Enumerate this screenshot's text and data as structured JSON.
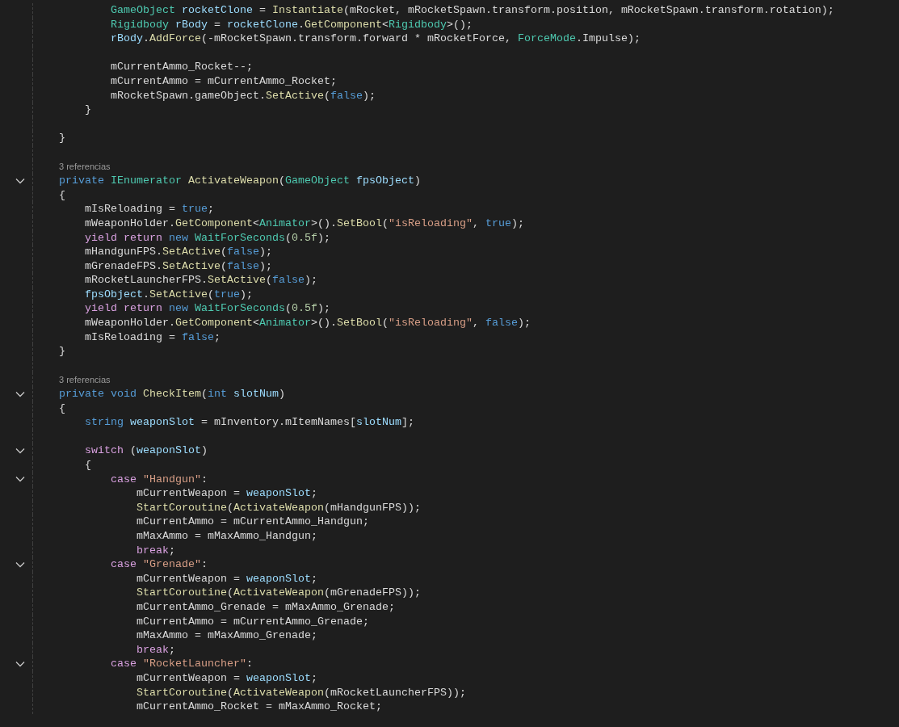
{
  "editor": {
    "lines": [
      {
        "kind": "block",
        "children": [
          {
            "kind": "block",
            "children": [
              {
                "kind": "block",
                "children": [
                  {
                    "kind": "code",
                    "tokens": [
                      {
                        "kind": "type",
                        "text": "GameObject"
                      },
                      {
                        "kind": "var",
                        "text": " rocketClone"
                      },
                      {
                        "kind": "txt",
                        "text": " = "
                      },
                      {
                        "kind": "fn",
                        "text": "Instantiate"
                      },
                      {
                        "kind": "txt",
                        "text": "(mRocket, mRocketSpawn.transform.position, mRocketSpawn.transform.rotation);"
                      }
                    ]
                  },
                  {
                    "kind": "code",
                    "tokens": [
                      {
                        "kind": "type",
                        "text": "Rigidbody"
                      },
                      {
                        "kind": "var",
                        "text": " rBody"
                      },
                      {
                        "kind": "txt",
                        "text": " = "
                      },
                      {
                        "kind": "var",
                        "text": "rocketClone"
                      },
                      {
                        "kind": "txt",
                        "text": "."
                      },
                      {
                        "kind": "fn",
                        "text": "GetComponent"
                      },
                      {
                        "kind": "txt",
                        "text": "<"
                      },
                      {
                        "kind": "type",
                        "text": "Rigidbody"
                      },
                      {
                        "kind": "txt",
                        "text": ">();"
                      }
                    ]
                  },
                  {
                    "kind": "code",
                    "tokens": [
                      {
                        "kind": "var",
                        "text": "rBody"
                      },
                      {
                        "kind": "txt",
                        "text": "."
                      },
                      {
                        "kind": "fn",
                        "text": "AddForce"
                      },
                      {
                        "kind": "txt",
                        "text": "(-mRocketSpawn.transform.forward * mRocketForce, "
                      },
                      {
                        "kind": "type",
                        "text": "ForceMode"
                      },
                      {
                        "kind": "txt",
                        "text": ".Impulse);"
                      }
                    ]
                  },
                  {
                    "kind": "blank"
                  },
                  {
                    "kind": "code",
                    "tokens": [
                      {
                        "kind": "txt",
                        "text": "mCurrentAmmo_Rocket--;"
                      }
                    ]
                  },
                  {
                    "kind": "code",
                    "tokens": [
                      {
                        "kind": "txt",
                        "text": "mCurrentAmmo = mCurrentAmmo_Rocket;"
                      }
                    ]
                  },
                  {
                    "kind": "code",
                    "tokens": [
                      {
                        "kind": "txt",
                        "text": "mRocketSpawn.gameObject."
                      },
                      {
                        "kind": "fn",
                        "text": "SetActive"
                      },
                      {
                        "kind": "txt",
                        "text": "("
                      },
                      {
                        "kind": "kw",
                        "text": "false"
                      },
                      {
                        "kind": "txt",
                        "text": ");"
                      }
                    ]
                  }
                ]
              },
              {
                "kind": "code",
                "tokens": [
                  {
                    "kind": "txt",
                    "text": "}"
                  }
                ]
              }
            ]
          },
          {
            "kind": "blank"
          },
          {
            "kind": "code",
            "tokens": [
              {
                "kind": "txt",
                "text": "}"
              }
            ]
          },
          {
            "kind": "blank"
          },
          {
            "kind": "lens",
            "text": "3 referencias"
          },
          {
            "kind": "code",
            "expanded": true,
            "tokens": [
              {
                "kind": "kw",
                "text": "private"
              },
              {
                "kind": "type",
                "text": " IEnumerator"
              },
              {
                "kind": "fn",
                "text": " ActivateWeapon"
              },
              {
                "kind": "txt",
                "text": "("
              },
              {
                "kind": "type",
                "text": "GameObject"
              },
              {
                "kind": "var",
                "text": " fpsObject"
              },
              {
                "kind": "txt",
                "text": ")"
              }
            ]
          },
          {
            "kind": "code",
            "tokens": [
              {
                "kind": "txt",
                "text": "{"
              }
            ]
          },
          {
            "kind": "block",
            "children": [
              {
                "kind": "code",
                "tokens": [
                  {
                    "kind": "txt",
                    "text": "mIsReloading = "
                  },
                  {
                    "kind": "kw",
                    "text": "true"
                  },
                  {
                    "kind": "txt",
                    "text": ";"
                  }
                ]
              },
              {
                "kind": "code",
                "tokens": [
                  {
                    "kind": "txt",
                    "text": "mWeaponHolder."
                  },
                  {
                    "kind": "fn",
                    "text": "GetComponent"
                  },
                  {
                    "kind": "txt",
                    "text": "<"
                  },
                  {
                    "kind": "type",
                    "text": "Animator"
                  },
                  {
                    "kind": "txt",
                    "text": ">()."
                  },
                  {
                    "kind": "fn",
                    "text": "SetBool"
                  },
                  {
                    "kind": "txt",
                    "text": "("
                  },
                  {
                    "kind": "str",
                    "text": "\"isReloading\""
                  },
                  {
                    "kind": "txt",
                    "text": ", "
                  },
                  {
                    "kind": "kw",
                    "text": "true"
                  },
                  {
                    "kind": "txt",
                    "text": ");"
                  }
                ]
              },
              {
                "kind": "code",
                "tokens": [
                  {
                    "kind": "ctl",
                    "text": "yield return"
                  },
                  {
                    "kind": "kw",
                    "text": " new"
                  },
                  {
                    "kind": "type",
                    "text": " WaitForSeconds"
                  },
                  {
                    "kind": "txt",
                    "text": "("
                  },
                  {
                    "kind": "num",
                    "text": "0.5f"
                  },
                  {
                    "kind": "txt",
                    "text": ");"
                  }
                ]
              },
              {
                "kind": "code",
                "tokens": [
                  {
                    "kind": "txt",
                    "text": "mHandgunFPS."
                  },
                  {
                    "kind": "fn",
                    "text": "SetActive"
                  },
                  {
                    "kind": "txt",
                    "text": "("
                  },
                  {
                    "kind": "kw",
                    "text": "false"
                  },
                  {
                    "kind": "txt",
                    "text": ");"
                  }
                ]
              },
              {
                "kind": "code",
                "tokens": [
                  {
                    "kind": "txt",
                    "text": "mGrenadeFPS."
                  },
                  {
                    "kind": "fn",
                    "text": "SetActive"
                  },
                  {
                    "kind": "txt",
                    "text": "("
                  },
                  {
                    "kind": "kw",
                    "text": "false"
                  },
                  {
                    "kind": "txt",
                    "text": ");"
                  }
                ]
              },
              {
                "kind": "code",
                "tokens": [
                  {
                    "kind": "txt",
                    "text": "mRocketLauncherFPS."
                  },
                  {
                    "kind": "fn",
                    "text": "SetActive"
                  },
                  {
                    "kind": "txt",
                    "text": "("
                  },
                  {
                    "kind": "kw",
                    "text": "false"
                  },
                  {
                    "kind": "txt",
                    "text": ");"
                  }
                ]
              },
              {
                "kind": "code",
                "tokens": [
                  {
                    "kind": "var",
                    "text": "fpsObject"
                  },
                  {
                    "kind": "txt",
                    "text": "."
                  },
                  {
                    "kind": "fn",
                    "text": "SetActive"
                  },
                  {
                    "kind": "txt",
                    "text": "("
                  },
                  {
                    "kind": "kw",
                    "text": "true"
                  },
                  {
                    "kind": "txt",
                    "text": ");"
                  }
                ]
              },
              {
                "kind": "code",
                "tokens": [
                  {
                    "kind": "ctl",
                    "text": "yield return"
                  },
                  {
                    "kind": "kw",
                    "text": " new"
                  },
                  {
                    "kind": "type",
                    "text": " WaitForSeconds"
                  },
                  {
                    "kind": "txt",
                    "text": "("
                  },
                  {
                    "kind": "num",
                    "text": "0.5f"
                  },
                  {
                    "kind": "txt",
                    "text": ");"
                  }
                ]
              },
              {
                "kind": "code",
                "tokens": [
                  {
                    "kind": "txt",
                    "text": "mWeaponHolder."
                  },
                  {
                    "kind": "fn",
                    "text": "GetComponent"
                  },
                  {
                    "kind": "txt",
                    "text": "<"
                  },
                  {
                    "kind": "type",
                    "text": "Animator"
                  },
                  {
                    "kind": "txt",
                    "text": ">()."
                  },
                  {
                    "kind": "fn",
                    "text": "SetBool"
                  },
                  {
                    "kind": "txt",
                    "text": "("
                  },
                  {
                    "kind": "str",
                    "text": "\"isReloading\""
                  },
                  {
                    "kind": "txt",
                    "text": ", "
                  },
                  {
                    "kind": "kw",
                    "text": "false"
                  },
                  {
                    "kind": "txt",
                    "text": ");"
                  }
                ]
              },
              {
                "kind": "code",
                "tokens": [
                  {
                    "kind": "txt",
                    "text": "mIsReloading = "
                  },
                  {
                    "kind": "kw",
                    "text": "false"
                  },
                  {
                    "kind": "txt",
                    "text": ";"
                  }
                ]
              }
            ]
          },
          {
            "kind": "code",
            "tokens": [
              {
                "kind": "txt",
                "text": "}"
              }
            ]
          },
          {
            "kind": "blank"
          },
          {
            "kind": "lens",
            "text": "3 referencias"
          },
          {
            "kind": "code",
            "expanded": true,
            "tokens": [
              {
                "kind": "kw",
                "text": "private"
              },
              {
                "kind": "kw",
                "text": " void"
              },
              {
                "kind": "fn",
                "text": " CheckItem"
              },
              {
                "kind": "txt",
                "text": "("
              },
              {
                "kind": "kw",
                "text": "int"
              },
              {
                "kind": "var",
                "text": " slotNum"
              },
              {
                "kind": "txt",
                "text": ")"
              }
            ]
          },
          {
            "kind": "code",
            "tokens": [
              {
                "kind": "txt",
                "text": "{"
              }
            ]
          },
          {
            "kind": "block",
            "children": [
              {
                "kind": "code",
                "tokens": [
                  {
                    "kind": "kw",
                    "text": "string"
                  },
                  {
                    "kind": "var",
                    "text": " weaponSlot"
                  },
                  {
                    "kind": "txt",
                    "text": " = mInventory.mItemNames["
                  },
                  {
                    "kind": "var",
                    "text": "slotNum"
                  },
                  {
                    "kind": "txt",
                    "text": "];"
                  }
                ]
              },
              {
                "kind": "blank"
              },
              {
                "kind": "code",
                "expanded": true,
                "tokens": [
                  {
                    "kind": "ctl",
                    "text": "switch"
                  },
                  {
                    "kind": "txt",
                    "text": " ("
                  },
                  {
                    "kind": "var",
                    "text": "weaponSlot"
                  },
                  {
                    "kind": "txt",
                    "text": ")"
                  }
                ]
              },
              {
                "kind": "code",
                "tokens": [
                  {
                    "kind": "txt",
                    "text": "{"
                  }
                ]
              },
              {
                "kind": "block",
                "children": [
                  {
                    "kind": "code",
                    "expanded": true,
                    "tokens": [
                      {
                        "kind": "ctl",
                        "text": "case"
                      },
                      {
                        "kind": "str",
                        "text": " \"Handgun\""
                      },
                      {
                        "kind": "txt",
                        "text": ":"
                      }
                    ]
                  },
                  {
                    "kind": "block",
                    "children": [
                      {
                        "kind": "code",
                        "tokens": [
                          {
                            "kind": "txt",
                            "text": "mCurrentWeapon = "
                          },
                          {
                            "kind": "var",
                            "text": "weaponSlot"
                          },
                          {
                            "kind": "txt",
                            "text": ";"
                          }
                        ]
                      },
                      {
                        "kind": "code",
                        "tokens": [
                          {
                            "kind": "fn",
                            "text": "StartCoroutine"
                          },
                          {
                            "kind": "txt",
                            "text": "("
                          },
                          {
                            "kind": "fn",
                            "text": "ActivateWeapon"
                          },
                          {
                            "kind": "txt",
                            "text": "(mHandgunFPS));"
                          }
                        ]
                      },
                      {
                        "kind": "code",
                        "tokens": [
                          {
                            "kind": "txt",
                            "text": "mCurrentAmmo = mCurrentAmmo_Handgun;"
                          }
                        ]
                      },
                      {
                        "kind": "code",
                        "tokens": [
                          {
                            "kind": "txt",
                            "text": "mMaxAmmo = mMaxAmmo_Handgun;"
                          }
                        ]
                      },
                      {
                        "kind": "code",
                        "tokens": [
                          {
                            "kind": "ctl",
                            "text": "break"
                          },
                          {
                            "kind": "txt",
                            "text": ";"
                          }
                        ]
                      }
                    ]
                  },
                  {
                    "kind": "code",
                    "expanded": true,
                    "tokens": [
                      {
                        "kind": "ctl",
                        "text": "case"
                      },
                      {
                        "kind": "str",
                        "text": " \"Grenade\""
                      },
                      {
                        "kind": "txt",
                        "text": ":"
                      }
                    ]
                  },
                  {
                    "kind": "block",
                    "children": [
                      {
                        "kind": "code",
                        "tokens": [
                          {
                            "kind": "txt",
                            "text": "mCurrentWeapon = "
                          },
                          {
                            "kind": "var",
                            "text": "weaponSlot"
                          },
                          {
                            "kind": "txt",
                            "text": ";"
                          }
                        ]
                      },
                      {
                        "kind": "code",
                        "tokens": [
                          {
                            "kind": "fn",
                            "text": "StartCoroutine"
                          },
                          {
                            "kind": "txt",
                            "text": "("
                          },
                          {
                            "kind": "fn",
                            "text": "ActivateWeapon"
                          },
                          {
                            "kind": "txt",
                            "text": "(mGrenadeFPS));"
                          }
                        ]
                      },
                      {
                        "kind": "code",
                        "tokens": [
                          {
                            "kind": "txt",
                            "text": "mCurrentAmmo_Grenade = mMaxAmmo_Grenade;"
                          }
                        ]
                      },
                      {
                        "kind": "code",
                        "tokens": [
                          {
                            "kind": "txt",
                            "text": "mCurrentAmmo = mCurrentAmmo_Grenade;"
                          }
                        ]
                      },
                      {
                        "kind": "code",
                        "tokens": [
                          {
                            "kind": "txt",
                            "text": "mMaxAmmo = mMaxAmmo_Grenade;"
                          }
                        ]
                      },
                      {
                        "kind": "code",
                        "tokens": [
                          {
                            "kind": "ctl",
                            "text": "break"
                          },
                          {
                            "kind": "txt",
                            "text": ";"
                          }
                        ]
                      }
                    ]
                  },
                  {
                    "kind": "code",
                    "expanded": true,
                    "tokens": [
                      {
                        "kind": "ctl",
                        "text": "case"
                      },
                      {
                        "kind": "str",
                        "text": " \"RocketLauncher\""
                      },
                      {
                        "kind": "txt",
                        "text": ":"
                      }
                    ]
                  },
                  {
                    "kind": "block",
                    "children": [
                      {
                        "kind": "code",
                        "tokens": [
                          {
                            "kind": "txt",
                            "text": "mCurrentWeapon = "
                          },
                          {
                            "kind": "var",
                            "text": "weaponSlot"
                          },
                          {
                            "kind": "txt",
                            "text": ";"
                          }
                        ]
                      },
                      {
                        "kind": "code",
                        "tokens": [
                          {
                            "kind": "fn",
                            "text": "StartCoroutine"
                          },
                          {
                            "kind": "txt",
                            "text": "("
                          },
                          {
                            "kind": "fn",
                            "text": "ActivateWeapon"
                          },
                          {
                            "kind": "txt",
                            "text": "(mRocketLauncherFPS));"
                          }
                        ]
                      },
                      {
                        "kind": "code",
                        "tokens": [
                          {
                            "kind": "txt",
                            "text": "mCurrentAmmo_Rocket = mMaxAmmo_Rocket;"
                          }
                        ]
                      }
                    ]
                  }
                ]
              }
            ]
          }
        ]
      }
    ]
  }
}
